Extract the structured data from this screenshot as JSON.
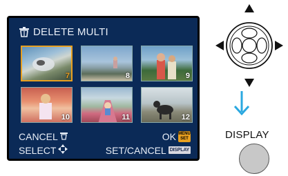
{
  "screen": {
    "title": "DELETE MULTI",
    "thumbnails": [
      {
        "number": "7",
        "highlight": "orange"
      },
      {
        "number": "8",
        "highlight": "white"
      },
      {
        "number": "9",
        "highlight": "white"
      },
      {
        "number": "10",
        "highlight": "white"
      },
      {
        "number": "11",
        "highlight": "white"
      },
      {
        "number": "12",
        "highlight": "white"
      }
    ],
    "cancel_label": "CANCEL",
    "ok_label": "OK",
    "menu_set_top": "MENU",
    "menu_set_bottom": "SET",
    "select_label": "SELECT",
    "set_cancel_label": "SET/CANCEL",
    "display_badge": "DISPLAY"
  },
  "controls": {
    "display_label": "DISPLAY"
  },
  "colors": {
    "screen_bg": "#0b2a57",
    "accent": "#e8a020",
    "arrow": "#2aa8e0"
  },
  "icons": [
    "trash-icon",
    "cross-key-icon",
    "down-arrow-icon"
  ]
}
